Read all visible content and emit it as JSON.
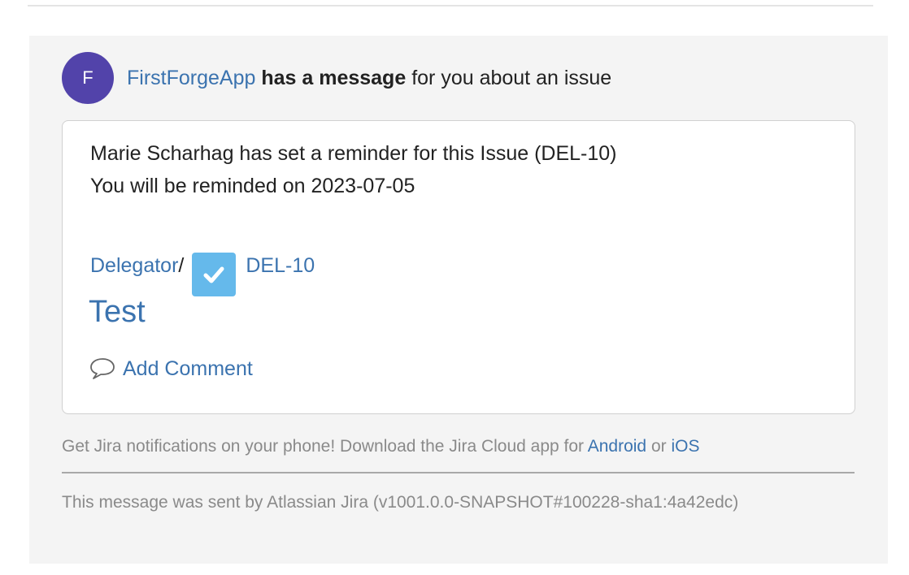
{
  "header": {
    "avatar_letter": "F",
    "app_name": "FirstForgeApp",
    "bold_text": "has a message",
    "rest_text": " for you about an issue"
  },
  "card": {
    "line1": "Marie Scharhag has set a reminder for this Issue (DEL-10)",
    "line2": "You will be reminded on 2023-07-05",
    "project": "Delegator",
    "separator": " /",
    "issue_key": "DEL-10",
    "issue_type_icon": "task-checkbox-icon",
    "summary": "Test",
    "add_comment": "Add Comment"
  },
  "footer": {
    "phone_text": "Get Jira notifications on your phone! Download the Jira Cloud app for ",
    "android": "Android",
    "or": " or ",
    "ios": "iOS",
    "sent_by": "This message was sent by Atlassian Jira (v1001.0.0-SNAPSHOT#100228-sha1:4a42edc)"
  },
  "colors": {
    "avatar": "#5243aa",
    "link": "#3b73af",
    "panel_bg": "#f4f4f4"
  }
}
